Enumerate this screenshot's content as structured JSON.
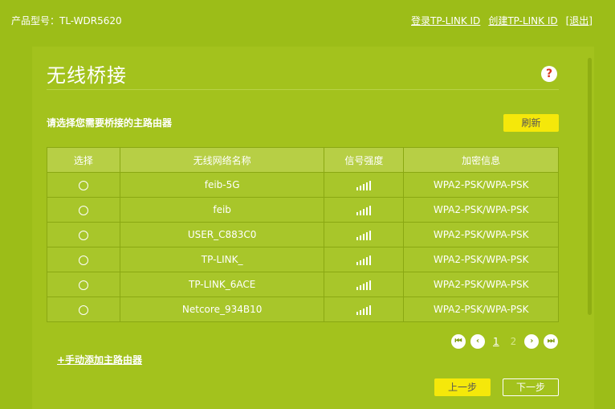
{
  "header": {
    "model_label": "产品型号：TL-WDR5620",
    "links": [
      "登录TP-LINK ID",
      "创建TP-LINK ID",
      "[退出]"
    ]
  },
  "main": {
    "title": "无线桥接",
    "help_glyph": "?",
    "prompt": "请选择您需要桥接的主路由器",
    "refresh_label": "刷新",
    "table": {
      "headers": [
        "选择",
        "无线网络名称",
        "信号强度",
        "加密信息"
      ],
      "rows": [
        {
          "ssid": "feib-5G",
          "signal_level": 5,
          "security": "WPA2-PSK/WPA-PSK"
        },
        {
          "ssid": "feib",
          "signal_level": 5,
          "security": "WPA2-PSK/WPA-PSK"
        },
        {
          "ssid": "USER_C883C0",
          "signal_level": 5,
          "security": "WPA2-PSK/WPA-PSK"
        },
        {
          "ssid": "TP-LINK_",
          "signal_level": 5,
          "security": "WPA2-PSK/WPA-PSK"
        },
        {
          "ssid": "TP-LINK_6ACE",
          "signal_level": 5,
          "security": "WPA2-PSK/WPA-PSK"
        },
        {
          "ssid": "Netcore_934B10",
          "signal_level": 5,
          "security": "WPA2-PSK/WPA-PSK"
        }
      ]
    },
    "pagination": {
      "first_glyph": "⏮",
      "prev_glyph": "‹",
      "next_glyph": "›",
      "last_glyph": "⏭",
      "pages": [
        "1",
        "2"
      ],
      "current_page": "1"
    },
    "add_router_link": "+手动添加主路由器",
    "prev_step_label": "上一步",
    "next_step_label": "下一步"
  },
  "colors": {
    "background": "#9cbd18",
    "accent_button": "#f5e80a",
    "table_header": "#b7cf45",
    "help_icon": "#d8361f"
  }
}
